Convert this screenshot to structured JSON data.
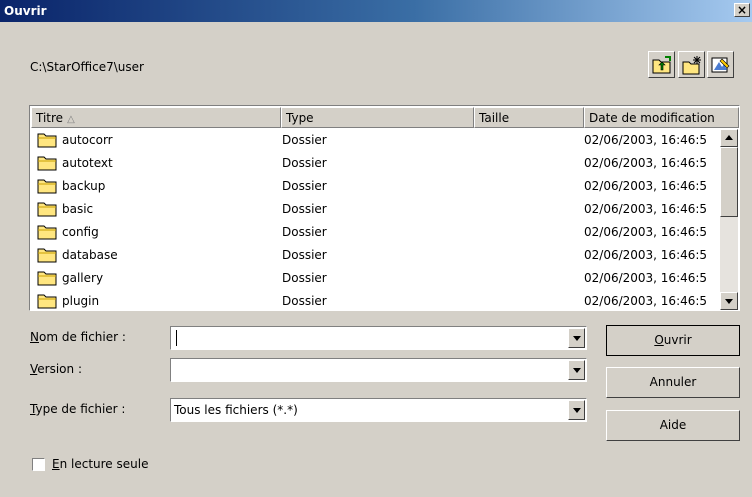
{
  "window": {
    "title": "Ouvrir",
    "close_glyph": "×"
  },
  "path": "C:\\StarOffice7\\user",
  "toolbar": [
    {
      "name": "up-one-level-icon"
    },
    {
      "name": "new-folder-icon"
    },
    {
      "name": "default-directory-icon"
    }
  ],
  "columns": {
    "name": "Titre",
    "type": "Type",
    "size": "Taille",
    "date": "Date de modification",
    "sort_indicator": "△"
  },
  "files": [
    {
      "name": "autocorr",
      "type": "Dossier",
      "size": "",
      "date": "02/06/2003, 16:46:5"
    },
    {
      "name": "autotext",
      "type": "Dossier",
      "size": "",
      "date": "02/06/2003, 16:46:5"
    },
    {
      "name": "backup",
      "type": "Dossier",
      "size": "",
      "date": "02/06/2003, 16:46:5"
    },
    {
      "name": "basic",
      "type": "Dossier",
      "size": "",
      "date": "02/06/2003, 16:46:5"
    },
    {
      "name": "config",
      "type": "Dossier",
      "size": "",
      "date": "02/06/2003, 16:46:5"
    },
    {
      "name": "database",
      "type": "Dossier",
      "size": "",
      "date": "02/06/2003, 16:46:5"
    },
    {
      "name": "gallery",
      "type": "Dossier",
      "size": "",
      "date": "02/06/2003, 16:46:5"
    },
    {
      "name": "plugin",
      "type": "Dossier",
      "size": "",
      "date": "02/06/2003, 16:46:5"
    }
  ],
  "form": {
    "filename": {
      "label_mn": "N",
      "label_rest": "om de fichier :",
      "value": ""
    },
    "version": {
      "label_mn": "V",
      "label_rest": "ersion :",
      "value": ""
    },
    "filetype": {
      "label_mn": "T",
      "label_rest": "ype de fichier :",
      "value": "Tous les fichiers (*.*)"
    }
  },
  "buttons": {
    "open_mn": "O",
    "open_rest": "uvrir",
    "cancel": "Annuler",
    "help": "Aide"
  },
  "readonly": {
    "label_mn": "E",
    "label_rest": "n lecture seule",
    "checked": false
  }
}
